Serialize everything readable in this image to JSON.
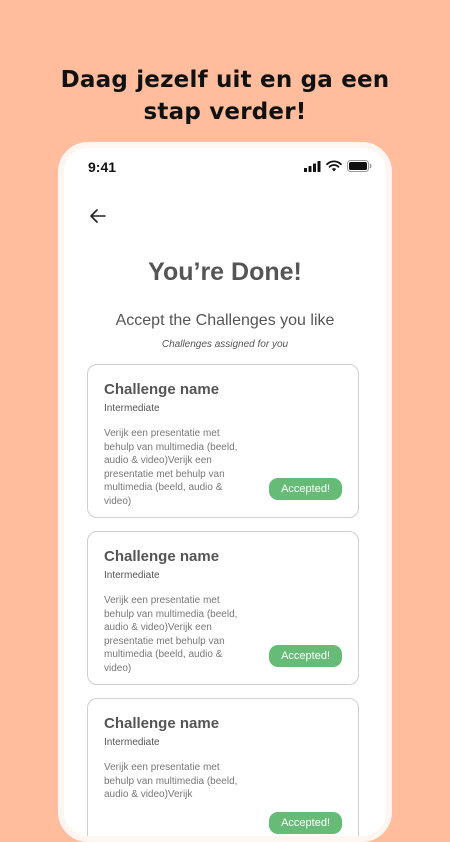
{
  "headline": {
    "line1": "Daag jezelf uit en ga een",
    "line2": "stap verder!"
  },
  "status_bar": {
    "time": "9:41",
    "icons": [
      "signal-icon",
      "wifi-icon",
      "battery-icon"
    ]
  },
  "page": {
    "back_icon": "arrow-left-icon",
    "title": "You’re Done!",
    "subtitle": "Accept the Challenges you like",
    "caption": "Challenges assigned for you"
  },
  "challenges": [
    {
      "name": "Challenge name",
      "level": "Intermediate",
      "description": "Verijk een presentatie met behulp van multimedia (beeld, audio & video)Verijk een presentatie met behulp van multimedia (beeld, audio & video)",
      "button": "Accepted!"
    },
    {
      "name": "Challenge name",
      "level": "Intermediate",
      "description": "Verijk een presentatie met behulp van multimedia (beeld, audio & video)Verijk een presentatie met behulp van multimedia (beeld, audio & video)",
      "button": "Accepted!"
    },
    {
      "name": "Challenge name",
      "level": "Intermediate",
      "description": "Verijk een presentatie met behulp van multimedia (beeld, audio & video)Verijk",
      "button": "Accepted!"
    }
  ],
  "colors": {
    "background": "#FFBD9D",
    "accent_green": "#66BB77",
    "text_dark": "#555555"
  }
}
